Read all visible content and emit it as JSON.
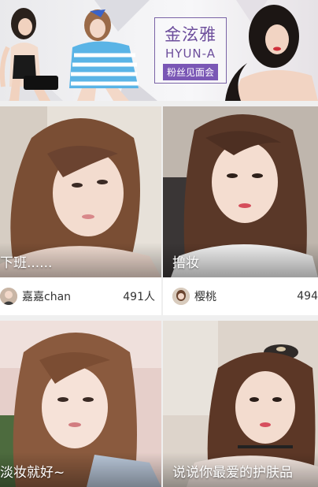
{
  "banner": {
    "title_cn": "金泫雅",
    "title_en": "HYUN-A",
    "subtitle": "粉丝见面会"
  },
  "cards": [
    {
      "caption": "下班......",
      "user": "嘉嘉chan",
      "viewers": "491人"
    },
    {
      "caption": "撸妆",
      "user": "樱桃",
      "viewers": "494"
    },
    {
      "caption": "淡妆就好~",
      "user": "",
      "viewers": ""
    },
    {
      "caption": "说说你最爱的护肤品",
      "user": "",
      "viewers": ""
    }
  ],
  "colors": {
    "banner_accent": "#6d4e9c",
    "banner_badge": "#7a57b5",
    "info_bg": "#ffffff"
  }
}
